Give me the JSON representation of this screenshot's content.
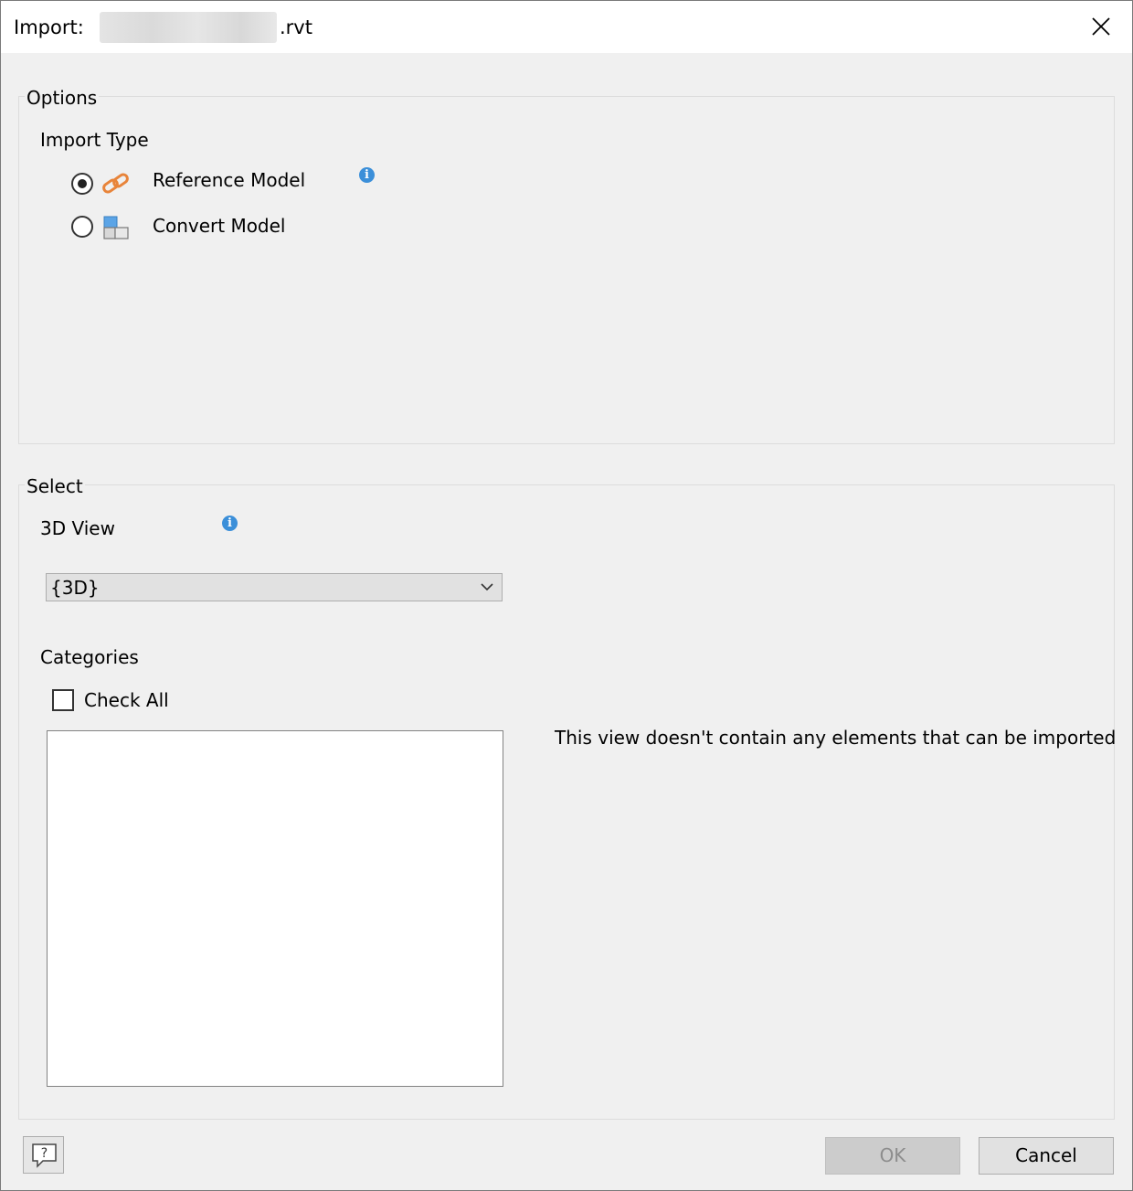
{
  "window": {
    "title_prefix": "Import:",
    "title_filename_suffix": ".rvt"
  },
  "options": {
    "legend": "Options",
    "import_type_label": "Import Type",
    "radios": [
      {
        "label": "Reference Model",
        "selected": true,
        "icon": "chain-link-icon"
      },
      {
        "label": "Convert Model",
        "selected": false,
        "icon": "cubes-icon"
      }
    ]
  },
  "select": {
    "legend": "Select",
    "view_label": "3D View",
    "view_value": "{3D}",
    "categories_label": "Categories",
    "check_all_label": "Check All",
    "check_all_checked": false,
    "empty_message": "This view doesn't contain any elements that can be imported"
  },
  "buttons": {
    "ok": "OK",
    "cancel": "Cancel",
    "help_icon": "help-question-icon"
  },
  "colors": {
    "info": "#3b8fd9",
    "link_icon": "#e8843a"
  }
}
